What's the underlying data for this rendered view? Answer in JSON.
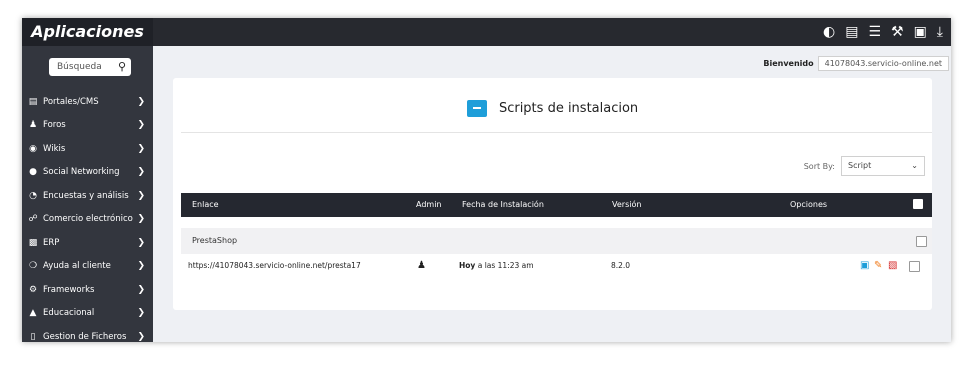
{
  "app": {
    "brand": "Aplicaciones"
  },
  "topbar": {
    "icons": [
      "dashboard-icon",
      "inbox-icon",
      "list-icon",
      "wrench-icon",
      "briefcase-icon",
      "download-icon"
    ]
  },
  "sidebar": {
    "search_placeholder": "Búsqueda",
    "items": [
      {
        "label": "Portales/CMS",
        "icon": "list-icon"
      },
      {
        "label": "Foros",
        "icon": "users-icon"
      },
      {
        "label": "Wikis",
        "icon": "globe-icon"
      },
      {
        "label": "Social Networking",
        "icon": "chat-icon"
      },
      {
        "label": "Encuestas y análisis",
        "icon": "pie-chart-icon"
      },
      {
        "label": "Comercio electrónico",
        "icon": "cart-icon"
      },
      {
        "label": "ERP",
        "icon": "bar-chart-icon"
      },
      {
        "label": "Ayuda al cliente",
        "icon": "help-icon"
      },
      {
        "label": "Frameworks",
        "icon": "gears-icon"
      },
      {
        "label": "Educacional",
        "icon": "graduation-cap-icon"
      },
      {
        "label": "Gestion de Ficheros",
        "icon": "files-icon"
      }
    ]
  },
  "header": {
    "welcome": "Bienvenido",
    "host": "41078043.servicio-online.net"
  },
  "main": {
    "title": "Scripts de instalacion",
    "sort_label": "Sort By:",
    "sort_value": "Script",
    "columns": {
      "link": "Enlace",
      "admin": "Admin",
      "date": "Fecha de Instalación",
      "version": "Versión",
      "options": "Opciones"
    },
    "group": "PrestaShop",
    "rows": [
      {
        "link": "https://41078043.servicio-online.net/presta17",
        "date_bold": "Hoy",
        "date_rest": " a las 11:23 am",
        "version": "8.2.0"
      }
    ]
  },
  "colors": {
    "accent": "#1e9ed9",
    "highlight": "#ee7c31",
    "sidebar": "#33363e",
    "topbar": "#27292f"
  }
}
